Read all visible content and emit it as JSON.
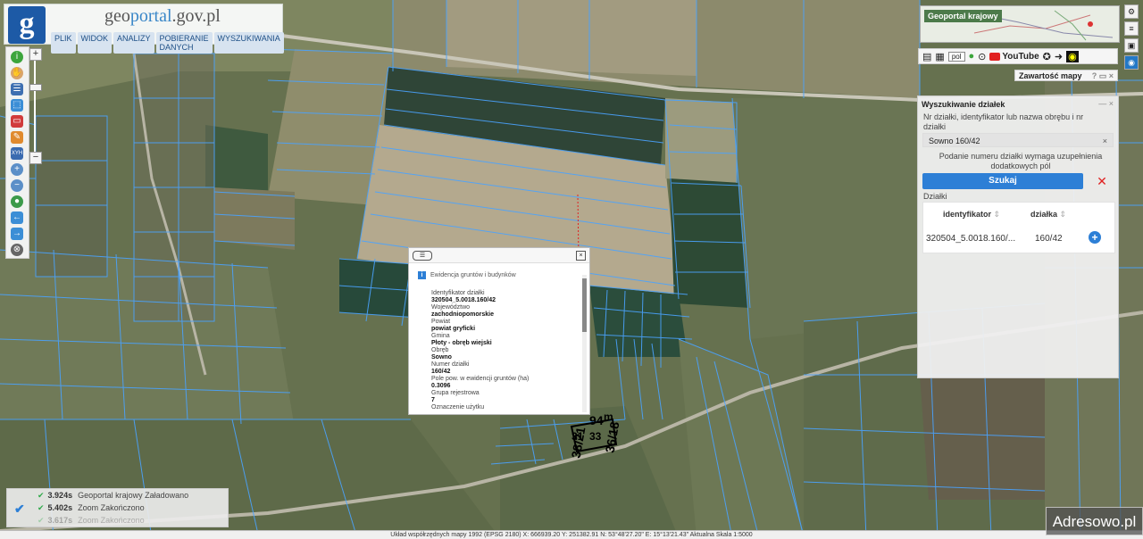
{
  "header": {
    "logo_letter": "g",
    "site_name_a": "geo",
    "site_name_b": "portal",
    "site_name_c": ".gov.pl",
    "menu": [
      "PLIK",
      "WIDOK",
      "ANALIZY",
      "POBIERANIE DANYCH",
      "WYSZUKIWANIA"
    ]
  },
  "toolbar": {
    "zoom_in": "+",
    "zoom_out": "−",
    "xy_label": "XYH"
  },
  "minimap": {
    "label": "Geoportal krajowy"
  },
  "controls": {
    "language": "pol",
    "youtube_label": "YouTube"
  },
  "content_panel": {
    "label": "Zawartość mapy"
  },
  "search_panel": {
    "title": "Wyszukiwanie działek",
    "description": "Nr działki, identyfikator lub nazwa obrębu i nr działki",
    "input_value": "Sowno 160/42",
    "clear_symbol": "×",
    "note": "Podanie numeru działki wymaga uzupełnienia dodatkowych pól",
    "search_button": "Szukaj",
    "results_label": "Działki",
    "columns": [
      "identyfikator",
      "działka"
    ],
    "rows": [
      {
        "identyfikator": "320504_5.0018.160/...",
        "dzialka": "160/42"
      }
    ]
  },
  "popup": {
    "section": "Ewidencja gruntów i budynków",
    "fields": [
      {
        "label": "Identyfikator działki",
        "value": "320504_5.0018.160/42"
      },
      {
        "label": "Województwo",
        "value": "zachodniopomorskie"
      },
      {
        "label": "Powiat",
        "value": "powiat gryficki"
      },
      {
        "label": "Gmina",
        "value": "Płoty - obręb wiejski"
      },
      {
        "label": "Obręb",
        "value": "Sowno"
      },
      {
        "label": "Numer działki",
        "value": "160/42"
      },
      {
        "label": "Pole pow. w ewidencji gruntów (ha)",
        "value": "0.3096"
      },
      {
        "label": "Grupa rejestrowa",
        "value": "7"
      },
      {
        "label": "Oznaczenie użytku",
        "value": ""
      }
    ]
  },
  "map_labels": [
    "38/21",
    "94",
    "31",
    "33",
    "36/18",
    "m"
  ],
  "log": [
    {
      "time": "3.924s",
      "source": "Geoportal krajowy",
      "status": "Załadowano"
    },
    {
      "time": "5.402s",
      "source": "Zoom",
      "status": "Zakończono"
    },
    {
      "time": "3.617s",
      "source": "Zoom",
      "status": "Zakończono"
    }
  ],
  "statusbar": "Układ współrzędnych mapy 1992 (EPSG 2180)   X: 666939.20 Y: 251382.91   N: 53°48'27.20\" E: 15°13'21.43\"   Aktualna Skala 1:5000",
  "watermark": "Adresowo.pl",
  "colors": {
    "accent": "#2d7fd6",
    "parcel_lines": "#4aa3ff",
    "danger": "#e02222"
  }
}
